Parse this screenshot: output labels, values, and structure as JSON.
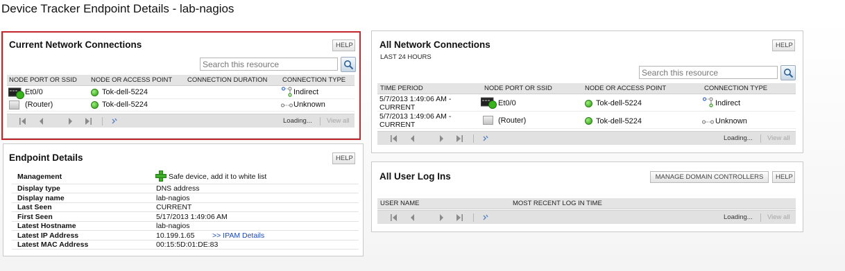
{
  "page": {
    "title": "Device Tracker Endpoint Details - lab-nagios"
  },
  "colors": {
    "highlight_frame": "#c2272d",
    "status_up": "#2a9a12",
    "link": "#1a46b4"
  },
  "current_connections": {
    "title": "Current Network Connections",
    "help_label": "HELP",
    "search_placeholder": "Search this resource",
    "columns": [
      "NODE PORT OR SSID",
      "NODE OR ACCESS POINT",
      "CONNECTION DURATION",
      "CONNECTION TYPE"
    ],
    "rows": [
      {
        "port": "Et0/0",
        "port_icon": "switch-port-up-icon",
        "node": "Tok-dell-5224",
        "node_status": "up",
        "duration": "",
        "type": "Indirect",
        "type_icon": "indirect-connection-icon"
      },
      {
        "port": "(Router)",
        "port_icon": "router-icon",
        "node": "Tok-dell-5224",
        "node_status": "up",
        "duration": "",
        "type": "Unknown",
        "type_icon": "unknown-connection-icon"
      }
    ],
    "pager": {
      "loading": "Loading...",
      "view_all": "View all"
    }
  },
  "endpoint_details": {
    "title": "Endpoint Details",
    "help_label": "HELP",
    "management": {
      "label": "Management",
      "action": "Safe device, add it to white list"
    },
    "rows": [
      {
        "key": "Display type",
        "value": "DNS address"
      },
      {
        "key": "Display name",
        "value": "lab-nagios"
      },
      {
        "key": "Last Seen",
        "value": "CURRENT"
      },
      {
        "key": "First Seen",
        "value": "5/17/2013 1:49:06 AM"
      },
      {
        "key": "Latest Hostname",
        "value": "lab-nagios"
      },
      {
        "key": "Latest IP Address",
        "value": "10.199.1.65",
        "link": ">> IPAM Details"
      },
      {
        "key": "Latest MAC Address",
        "value": "00:15:5D:01:DE:83"
      }
    ]
  },
  "all_connections": {
    "title": "All Network Connections",
    "subtitle": "LAST 24 HOURS",
    "help_label": "HELP",
    "search_placeholder": "Search this resource",
    "columns": [
      "TIME PERIOD",
      "NODE PORT OR SSID",
      "NODE OR ACCESS POINT",
      "CONNECTION TYPE"
    ],
    "rows": [
      {
        "time_line1": "5/7/2013 1:49:06 AM -",
        "time_line2": "CURRENT",
        "port": "Et0/0",
        "node": "Tok-dell-5224",
        "type": "Indirect"
      },
      {
        "time_line1": "5/7/2013 1:49:06 AM -",
        "time_line2": "CURRENT",
        "port": "(Router)",
        "node": "Tok-dell-5224",
        "type": "Unknown"
      }
    ],
    "pager": {
      "loading": "Loading...",
      "view_all": "View all"
    }
  },
  "all_user_logins": {
    "title": "All User Log Ins",
    "manage_label": "MANAGE DOMAIN CONTROLLERS",
    "help_label": "HELP",
    "columns": [
      "USER NAME",
      "MOST RECENT LOG IN TIME"
    ],
    "pager": {
      "loading": "Loading...",
      "view_all": "View all"
    }
  }
}
